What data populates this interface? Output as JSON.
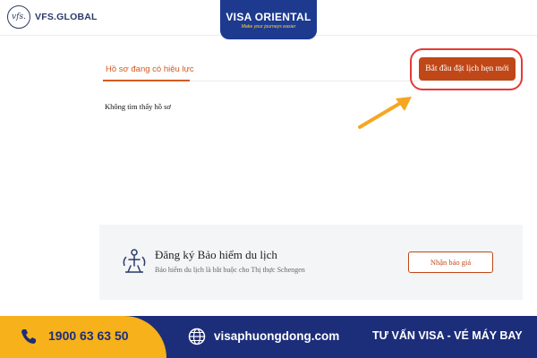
{
  "header": {
    "vfs_logo_mark": "vfs.",
    "vfs_logo_text": "VFS.GLOBAL",
    "brand_name": "VISA ORIENTAL",
    "brand_tagline": "Make your journeys easier"
  },
  "tabs": {
    "active_label": "Hồ sơ đang có hiệu lực"
  },
  "actions": {
    "start_button_label": "Bắt đầu đặt lịch hẹn mới"
  },
  "content": {
    "empty_message": "Không tìm thấy hồ sơ"
  },
  "insurance": {
    "title": "Đăng ký Bảo hiểm du lịch",
    "subtitle": "Bảo hiểm du lịch là bắt buộc cho Thị thực Schengen",
    "quote_button_label": "Nhận báo giá"
  },
  "footer": {
    "phone": "1900 63 63 50",
    "website": "visaphuongdong.com",
    "slogan": "TƯ VẤN VISA - VÉ MÁY BAY"
  },
  "colors": {
    "accent": "#c04717",
    "highlight_ring": "#e53935",
    "arrow": "#f5a623",
    "brand_blue": "#1d3a8f",
    "footer_blue": "#1c2e7a",
    "footer_yellow": "#f6b11b"
  }
}
